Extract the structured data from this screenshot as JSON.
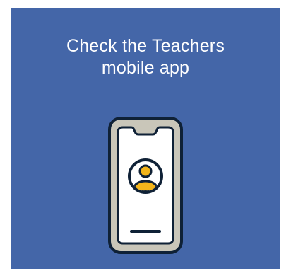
{
  "card": {
    "headline_lines": [
      "Check the Teachers",
      "mobile app"
    ]
  },
  "illustration": {
    "icon": "smartphone-icon",
    "screen_icon": "user-profile-icon"
  },
  "colors": {
    "background": "#4466a8",
    "text": "#ffffff",
    "phone_outline": "#0f2136",
    "phone_frame": "#c9c6b9",
    "screen": "#ffffff",
    "avatar": "#f3b51b"
  }
}
